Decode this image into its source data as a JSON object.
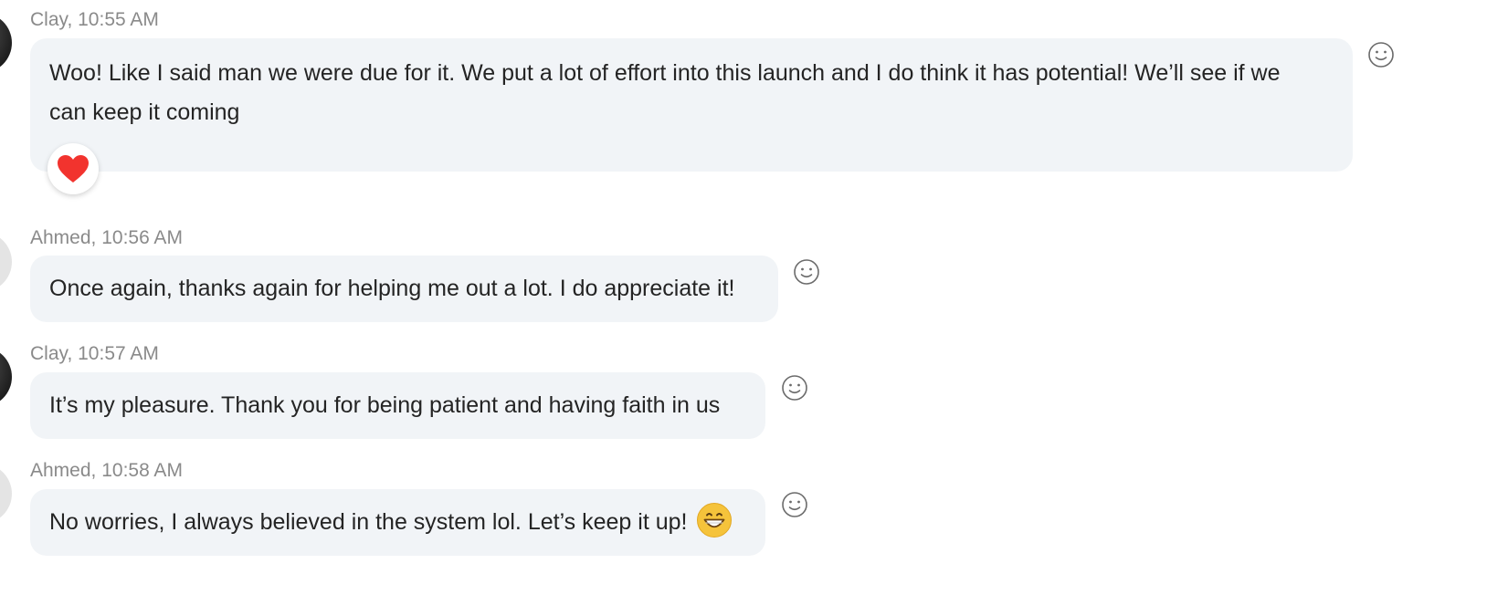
{
  "messages": [
    {
      "sender": "Clay",
      "time": "10:55 AM",
      "meta": "Clay, 10:55 AM",
      "lines": [
        "Woo! Like I said man we were due for it. We put a lot of effort into this launch and I do think it has potential! We’ll see if we",
        "can keep it coming"
      ],
      "reaction": "heart-icon"
    },
    {
      "sender": "Ahmed",
      "time": "10:56 AM",
      "meta": "Ahmed, 10:56 AM",
      "text": "Once again, thanks again for helping me out a lot. I do appreciate it!"
    },
    {
      "sender": "Clay",
      "time": "10:57 AM",
      "meta": "Clay, 10:57 AM",
      "text": "It’s my pleasure. Thank you for being patient and having faith in us"
    },
    {
      "sender": "Ahmed",
      "time": "10:58 AM",
      "meta": "Ahmed, 10:58 AM",
      "text": "No worries, I always believed in the system lol. Let’s keep it up!",
      "inline_emoji": "grinning-face-icon"
    }
  ],
  "colors": {
    "bubble": "#f1f4f7",
    "meta_text": "#8a8a8a",
    "heart": "#f2332e",
    "emoji": "#f5c33b"
  }
}
